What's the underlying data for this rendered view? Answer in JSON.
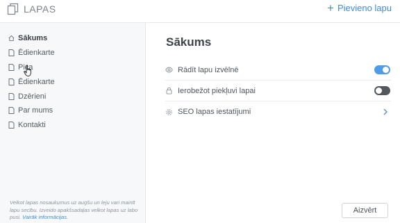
{
  "header": {
    "title": "LAPAS",
    "add_page_label": "Pievieno lapu",
    "logo_icon": "pages-icon",
    "add_icon": "plus-icon"
  },
  "sidebar": {
    "items": [
      {
        "label": "Sākums",
        "icon": "home-icon",
        "active": true
      },
      {
        "label": "Ēdienkarte",
        "icon": "page-icon",
        "active": false
      },
      {
        "label": "Pica",
        "icon": "page-icon",
        "active": false
      },
      {
        "label": "Ēdienkarte",
        "icon": "page-icon",
        "active": false
      },
      {
        "label": "Dzērieni",
        "icon": "page-icon",
        "active": false
      },
      {
        "label": "Par mums",
        "icon": "page-icon",
        "active": false
      },
      {
        "label": "Kontakti",
        "icon": "page-icon",
        "active": false
      }
    ],
    "note_text": "Velkot lapas nosaukumus uz augšu un leju vari mainīt lapu secību. Izveido apakšsadaļas velkot lapas uz labo pusi.",
    "note_link": "Vairāk informācijas."
  },
  "main": {
    "title": "Sākums",
    "settings": [
      {
        "label": "Rādīt lapu izvēlnē",
        "icon": "eye-icon",
        "control": "toggle",
        "state": "on"
      },
      {
        "label": "Ierobežot piekļuvi lapai",
        "icon": "lock-icon",
        "control": "toggle",
        "state": "off"
      },
      {
        "label": "SEO lapas iestatījumi",
        "icon": "gear-icon",
        "control": "chevron"
      }
    ],
    "edit_button_label": "Aizvērt"
  },
  "colors": {
    "accent": "#3a8dde",
    "toggle_on": "#4e9be8",
    "toggle_off": "#53585e",
    "sidebar_bg": "#f7f8f9"
  }
}
